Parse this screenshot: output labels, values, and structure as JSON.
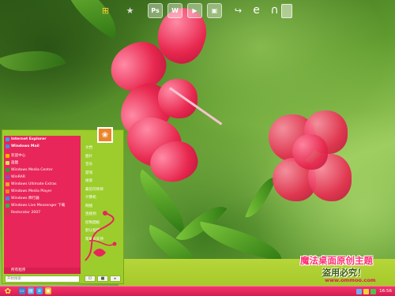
{
  "colors": {
    "accent_pink": "#e8265a",
    "accent_green": "#9ccd2c",
    "taskbar": "#d51c50"
  },
  "top_dock": {
    "icons": [
      {
        "name": "windows-flag-icon",
        "glyph": "⊞"
      },
      {
        "name": "star-icon",
        "glyph": "★"
      },
      {
        "name": "ps-icon",
        "glyph": "Ps"
      },
      {
        "name": "doc-icon",
        "glyph": "W"
      },
      {
        "name": "media-icon",
        "glyph": "▶"
      },
      {
        "name": "folder-icon",
        "glyph": "▣"
      },
      {
        "name": "arrow-icon",
        "glyph": "↪"
      },
      {
        "name": "ie-icon",
        "glyph": "e"
      },
      {
        "name": "headphones-icon",
        "glyph": "∩"
      }
    ]
  },
  "start_menu": {
    "pinned": [
      {
        "label": "Internet Explorer",
        "color": "#3aa0e8"
      },
      {
        "label": "Windows Mail",
        "color": "#4a8be0"
      }
    ],
    "programs": [
      {
        "label": "欢迎中心",
        "color": "#f5b400"
      },
      {
        "label": "画图",
        "color": "#d0e060"
      },
      {
        "label": "Windows Media Center",
        "color": "#2f9e3a"
      },
      {
        "label": "WinRAR",
        "color": "#8a4fb8"
      },
      {
        "label": "Windows Ultimate Extras",
        "color": "#f0a030"
      },
      {
        "label": "Windows Media Player",
        "color": "#f08a20"
      },
      {
        "label": "Windows 降行器",
        "color": "#3a8de0"
      },
      {
        "label": "Windows Live Messenger 下载",
        "color": "#36b24a"
      },
      {
        "label": "Restorator 2007",
        "color": "#c04040"
      }
    ],
    "all_programs": "所有程序",
    "search_placeholder": "开始搜索",
    "right_items": [
      "文档",
      "图片",
      "音乐",
      "游戏",
      "搜索",
      "最近的项目",
      "计算机",
      "网络",
      "连接到",
      "控制面板",
      "默认程序",
      "帮助和支持"
    ]
  },
  "brand": {
    "title": "魔法桌面原创主题",
    "slogan": "盗用必究！",
    "url": "www.ommoo.com"
  },
  "taskbar": {
    "clock": "16:56"
  }
}
